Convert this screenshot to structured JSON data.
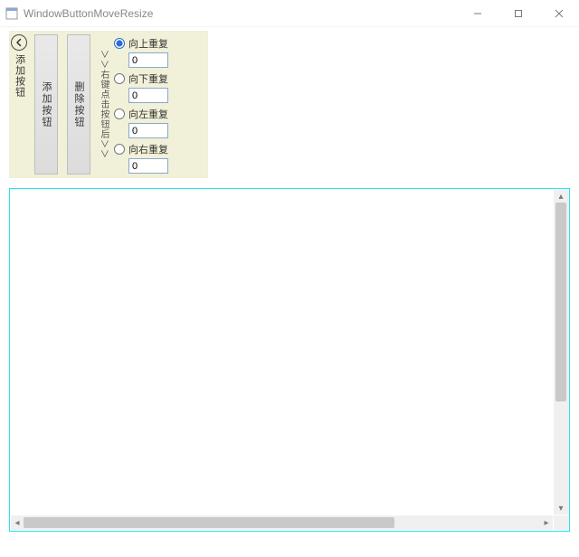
{
  "window": {
    "title": "WindowButtonMoveResize"
  },
  "panel": {
    "back_label": "添加按钮",
    "button_add": "添加按钮",
    "button_remove": "删除按钮",
    "hint": "＞＞右键点击按钮后＞＞",
    "repeat": {
      "up": {
        "label": "向上重复",
        "value": "0",
        "checked": true
      },
      "down": {
        "label": "向下重复",
        "value": "0",
        "checked": false
      },
      "left": {
        "label": "向左重复",
        "value": "0",
        "checked": false
      },
      "right": {
        "label": "向右重复",
        "value": "0",
        "checked": false
      }
    }
  }
}
